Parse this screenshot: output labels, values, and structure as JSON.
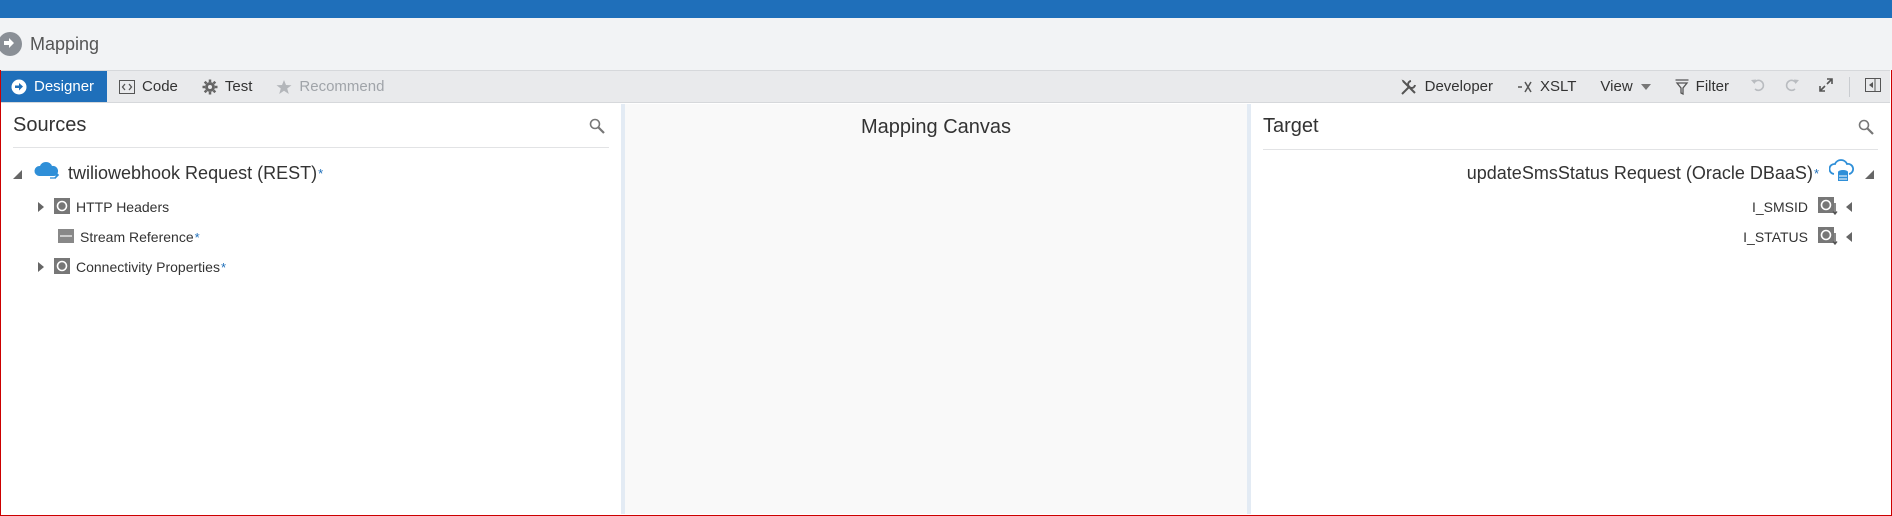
{
  "app": {
    "title": "Mapping"
  },
  "toolbar": {
    "designer": "Designer",
    "code": "Code",
    "test": "Test",
    "recommend": "Recommend",
    "developer": "Developer",
    "xslt": "XSLT",
    "view": "View",
    "filter": "Filter"
  },
  "sources": {
    "title": "Sources",
    "root": {
      "label": "twiliowebhook Request (REST)",
      "required": "*"
    },
    "items": [
      {
        "label": "HTTP Headers",
        "required": ""
      },
      {
        "label": "Stream Reference",
        "required": "*"
      },
      {
        "label": "Connectivity Properties",
        "required": "*"
      }
    ]
  },
  "canvas": {
    "title": "Mapping Canvas"
  },
  "target": {
    "title": "Target",
    "root": {
      "label": "updateSmsStatus Request (Oracle DBaaS)",
      "required": "*"
    },
    "items": [
      {
        "label": "I_SMSID"
      },
      {
        "label": "I_STATUS"
      }
    ]
  },
  "colors": {
    "accent": "#1f6fba",
    "toolbar_bg": "#e9eaec",
    "icon_blue": "#2f8fd8"
  }
}
